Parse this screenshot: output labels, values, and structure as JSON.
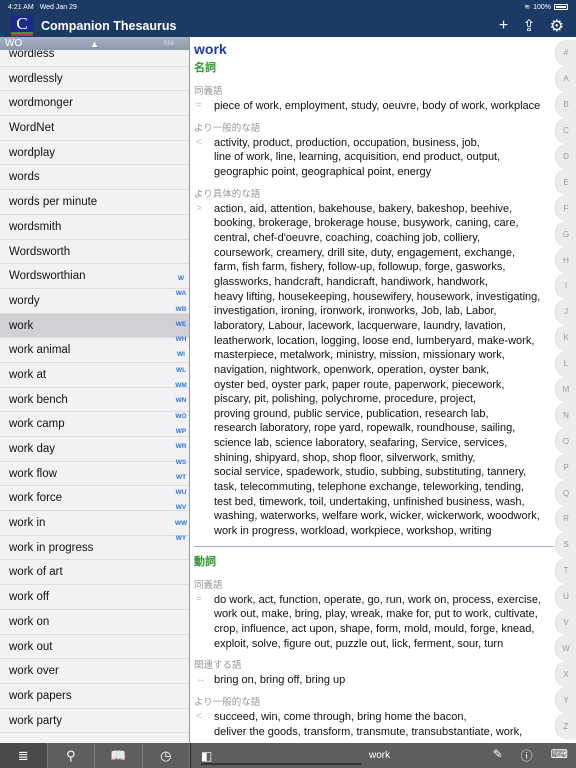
{
  "status": {
    "time": "4:21 AM",
    "date": "Wed Jan 29",
    "battery": "100%",
    "battery_level": 1.0
  },
  "app": {
    "title": "Companion Thesaurus",
    "logo_letter": "C",
    "actions": [
      {
        "icon": "plus-icon",
        "glyph": "+"
      },
      {
        "icon": "share-icon",
        "glyph": "⇪"
      },
      {
        "icon": "gear-icon",
        "glyph": "⚙"
      }
    ]
  },
  "sidebar": {
    "section": "WO",
    "section_arrow": "▲",
    "count": "566",
    "items": [
      "wordless",
      "wordlessly",
      "wordmonger",
      "WordNet",
      "wordplay",
      "words",
      "words per minute",
      "wordsmith",
      "Wordsworth",
      "Wordsworthian",
      "wordy",
      "work",
      "work animal",
      "work at",
      "work bench",
      "work camp",
      "work day",
      "work flow",
      "work force",
      "work in",
      "work in progress",
      "work of art",
      "work off",
      "work on",
      "work out",
      "work over",
      "work papers",
      "work party"
    ],
    "selected": "work",
    "sub_index": [
      "W",
      "WA",
      "WB",
      "WE",
      "WH",
      "WI",
      "WL",
      "WM",
      "WN",
      "WO",
      "WP",
      "WR",
      "WS",
      "WT",
      "WU",
      "WV",
      "WW",
      "WY"
    ]
  },
  "entry": {
    "word": "work",
    "sections": [
      {
        "pos": "名詞",
        "groups": [
          {
            "label": "同義語",
            "symbol": "=",
            "lines": [
              "piece of work, employment, study, oeuvre, body of work, workplace"
            ]
          },
          {
            "label": "より一般的な語",
            "symbol": "<",
            "lines": [
              "activity, product, production, occupation, business, job,",
              "line of work, line, learning, acquisition, end product, output,",
              "geographic point, geographical point, energy"
            ]
          },
          {
            "label": "より具体的な語",
            "symbol": ">",
            "lines": [
              "action, aid, attention, bakehouse, bakery, bakeshop, beehive,",
              "booking, brokerage, brokerage house, busywork, caning, care,",
              "central, chef-d'oeuvre, coaching, coaching job, colliery,",
              "coursework, creamery, drill site, duty, engagement, exchange,",
              "farm, fish farm, fishery, follow-up, followup, forge, gasworks,",
              "glassworks, handcraft, handicraft, handiwork, handwork,",
              "heavy lifting, housekeeping, housewifery, housework, investigating,",
              "investigation, ironing, ironwork, ironworks, Job, lab, Labor,",
              "laboratory, Labour, lacework, lacquerware, laundry, lavation,",
              "leatherwork, location, logging, loose end, lumberyard, make-work,",
              "masterpiece, metalwork, ministry, mission, missionary work,",
              "navigation, nightwork, openwork, operation, oyster bank,",
              "oyster bed, oyster park, paper route, paperwork, piecework,",
              "piscary, pit, polishing, polychrome, procedure, project,",
              "proving ground, public service, publication, research lab,",
              "research laboratory, rope yard, ropewalk, roundhouse, sailing,",
              "science lab, science laboratory, seafaring, Service, services,",
              "shining, shipyard, shop, shop floor, silverwork, smithy,",
              "social service, spadework, studio, subbing, substituting, tannery,",
              "task, telecommuting, telephone exchange, teleworking, tending,",
              "test bed, timework, toil, undertaking, unfinished business, wash,",
              "washing, waterworks, welfare work, wicker, wickerwork, woodwork,",
              "work in progress, workload, workpiece, workshop, writing"
            ]
          }
        ]
      },
      {
        "pos": "動詞",
        "groups": [
          {
            "label": "同義語",
            "symbol": "=",
            "lines": [
              "do work, act, function, operate, go, run, work on, process, exercise,",
              "work out, make, bring, play, wreak, make for, put to work, cultivate,",
              "crop, influence, act upon, shape, form, mold, mould, forge, knead,",
              "exploit, solve, figure out, puzzle out, lick, ferment, sour, turn"
            ]
          },
          {
            "label": "関連する語",
            "symbol": "↔",
            "lines": [
              "bring on, bring off, bring up"
            ]
          },
          {
            "label": "より一般的な語",
            "symbol": "<",
            "lines": [
              "succeed, win, come through, bring home the bacon,",
              "deliver the goods, transform, transmute, transubstantiate, work,"
            ]
          }
        ]
      }
    ]
  },
  "alpha_index": [
    "#",
    "A",
    "B",
    "C",
    "D",
    "E",
    "F",
    "G",
    "H",
    "I",
    "J",
    "K",
    "L",
    "M",
    "N",
    "O",
    "P",
    "Q",
    "R",
    "S",
    "T",
    "U",
    "V",
    "W",
    "X",
    "Y",
    "Z"
  ],
  "toolbar": {
    "tabs": [
      {
        "icon": "list-icon",
        "glyph": "≣"
      },
      {
        "icon": "search-icon",
        "glyph": "⚲"
      },
      {
        "icon": "book-icon",
        "glyph": "📖"
      },
      {
        "icon": "history-icon",
        "glyph": "◷"
      }
    ],
    "current_word": "work",
    "right": [
      {
        "icon": "edit-icon",
        "glyph": "✎"
      },
      {
        "icon": "info-icon",
        "glyph": "ⓘ"
      },
      {
        "icon": "keyboard-icon",
        "glyph": "⌨"
      }
    ]
  },
  "colors": {
    "header": "#1b3b65",
    "headword": "#1a3ea0",
    "pos": "#2e9a2e",
    "sub_index": "#2a7ae0",
    "toolbar": "#5e5e5e"
  }
}
